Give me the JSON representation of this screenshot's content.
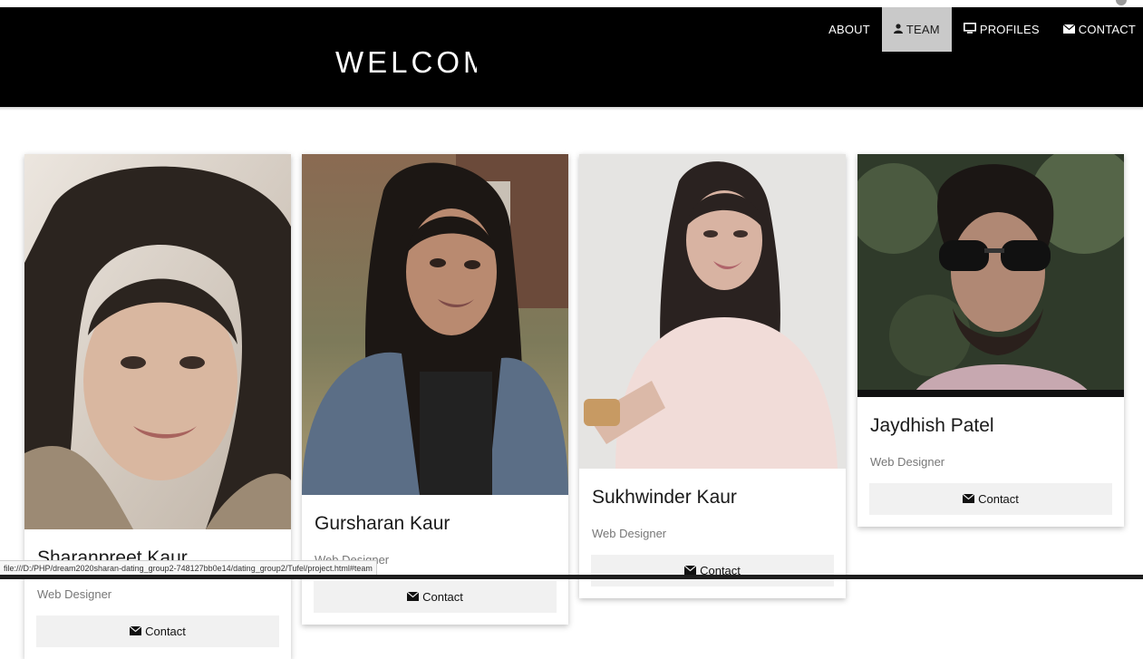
{
  "header": {
    "brand": "WELCOM",
    "nav": [
      {
        "label": "ABOUT",
        "icon": ""
      },
      {
        "label": "TEAM",
        "icon": "user-icon",
        "active": true
      },
      {
        "label": "PROFILES",
        "icon": "desktop-icon"
      },
      {
        "label": "CONTACT",
        "icon": "envelope-icon"
      }
    ]
  },
  "team": [
    {
      "name": "Sharanpreet Kaur",
      "role": "Web Designer",
      "contact_label": "Contact"
    },
    {
      "name": "Gursharan Kaur",
      "role": "Web Designer",
      "contact_label": "Contact"
    },
    {
      "name": "Sukhwinder Kaur",
      "role": "Web Designer",
      "contact_label": "Contact"
    },
    {
      "name": "Jaydhish Patel",
      "role": "Web Designer",
      "contact_label": "Contact"
    }
  ],
  "status_url": "file:///D:/PHP/dream2020sharan-dating_group2-748127bb0e14/dating_group2/Tufel/project.html#team",
  "colors": {
    "header_bg": "#000000",
    "active_nav_bg": "#c9c9c9",
    "button_bg": "#f1f1f1"
  }
}
